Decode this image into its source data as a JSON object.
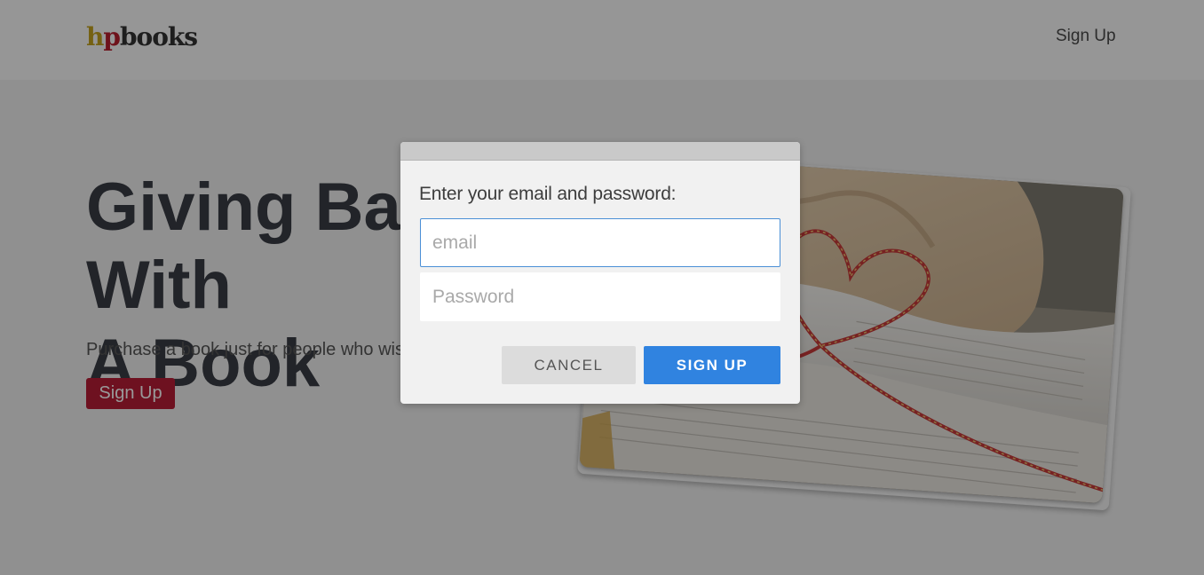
{
  "header": {
    "logo": {
      "part1": "h",
      "part2": "p",
      "part3": "books"
    },
    "nav_signup": "Sign Up"
  },
  "hero": {
    "title_line1": "Giving Back With",
    "title_line2": "A Book",
    "subtitle": "Purchase a book just for people who wis",
    "signup_button": "Sign Up"
  },
  "modal": {
    "prompt": "Enter your email and password:",
    "email": {
      "value": "",
      "placeholder": "email"
    },
    "password": {
      "value": "",
      "placeholder": "Password"
    },
    "cancel_label": "CANCEL",
    "signup_label": "SIGN UP"
  },
  "colors": {
    "logo_h": "#c3a21e",
    "logo_p": "#b81e2e",
    "brand_red": "#b71d36",
    "primary_blue": "#3083e0",
    "focus_border": "#4a8fd6"
  },
  "icons": {
    "hero_photo": "book-with-heart-string-photo"
  }
}
